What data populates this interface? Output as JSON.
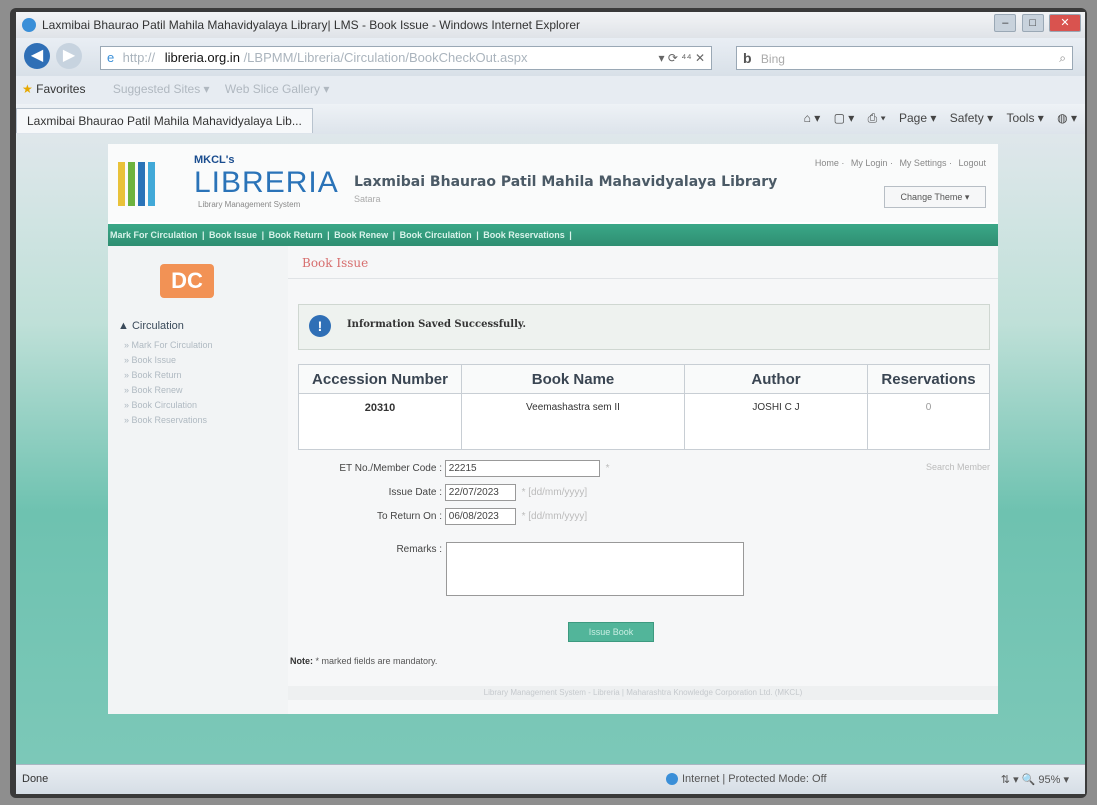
{
  "window": {
    "title": "Laxmibai Bhaurao Patil Mahila Mahavidyalaya Library| LMS - Book Issue - Windows Internet Explorer",
    "minimize": "–",
    "maximize": "□",
    "close": "✕"
  },
  "addressbar": {
    "back": "◀",
    "forward": "▶",
    "url_prefix": "http://",
    "url_domain": "libreria.org.in",
    "url_path": "/LBPMM/Libreria/Circulation/BookCheckOut.aspx",
    "controls": "▾  ⟳  ⁴⁴  ✕",
    "search_engine": "b",
    "search_placeholder": "Bing",
    "search_icon": "⌕"
  },
  "favorites": {
    "label": "Favorites",
    "suggested": "Suggested Sites ▾",
    "webslice": "Web Slice Gallery ▾"
  },
  "tab": {
    "label": "Laxmibai Bhaurao Patil Mahila Mahavidyalaya Lib..."
  },
  "commands": {
    "home": "⌂ ▾",
    "feeds": "▢ ▾",
    "print": "⎙ ▾",
    "page": "Page ▾",
    "safety": "Safety ▾",
    "tools": "Tools ▾",
    "help": "◍ ▾"
  },
  "site": {
    "mkcl": "MKCL's",
    "logo": "LIBRERIA",
    "logo_sub": "Library Management System",
    "library_name": "Laxmibai Bhaurao Patil Mahila Mahavidyalaya Library",
    "library_sub": "Satara",
    "toplinks": [
      "Home",
      "My Login",
      "My Settings",
      "Logout"
    ],
    "change_theme": "Change Theme ▾"
  },
  "menu": {
    "items": [
      "Mark For Circulation",
      "Book Issue",
      "Book Return",
      "Book Renew",
      "Book Circulation",
      "Book Reservations"
    ]
  },
  "sidebar": {
    "logo": "DC",
    "heading": "▲ Circulation",
    "items": [
      "Mark For Circulation",
      "Book Issue",
      "Book Return",
      "Book Renew",
      "Book Circulation",
      "Book Reservations"
    ]
  },
  "main": {
    "title": "Book Issue",
    "info_icon": "!",
    "info_message": "Information Saved Successfully.",
    "table": {
      "headers": [
        "Accession Number",
        "Book Name",
        "Author",
        "Reservations"
      ],
      "row": [
        "20310",
        "Veemashastra sem II",
        "JOSHI C J",
        "0"
      ]
    },
    "form": {
      "member_label": "ET No./Member Code :",
      "member_value": "22215",
      "issue_label": "Issue Date :",
      "issue_value": "22/07/2023",
      "return_label": "To Return On :",
      "return_value": "06/08/2023",
      "date_hint": "* [dd/mm/yyyy]",
      "remarks_label": "Remarks :",
      "mandatory_mark": "*",
      "search_member": "Search Member"
    },
    "issue_button": "Issue Book",
    "note_label": "Note:",
    "note_text": " * marked fields are mandatory.",
    "footer": "Library Management System - Libreria | Maharashtra Knowledge Corporation Ltd. (MKCL)"
  },
  "status": {
    "done": "Done",
    "zone": "Internet | Protected Mode: Off",
    "zoom": "⇅ ▾   🔍 95%  ▾"
  },
  "colors": {
    "menu_bar": "#3aa888",
    "title_red": "#d76e6e",
    "logo_blue": "#2a73b8",
    "dc_orange": "#f29255"
  }
}
